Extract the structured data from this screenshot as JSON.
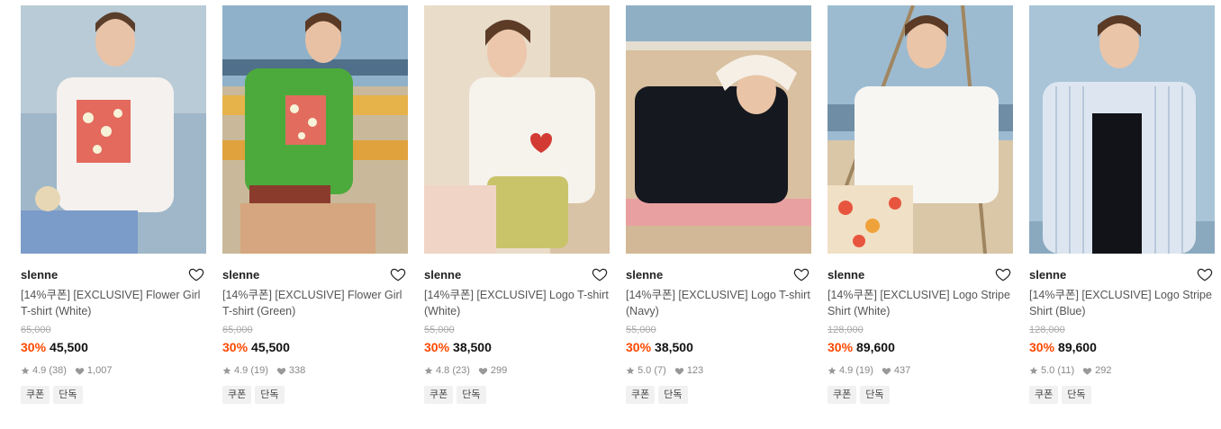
{
  "colors": {
    "discount": "#ff4800",
    "tag_bg": "#f1f1f1"
  },
  "products": [
    {
      "brand": "slenne",
      "title": "[14%쿠폰] [EXCLUSIVE] Flower Girl T-shirt (White)",
      "original_price": "65,000",
      "discount": "30%",
      "price": "45,500",
      "rating": "4.9",
      "reviews": "(38)",
      "likes": "1,007",
      "tags": [
        "쿠폰",
        "단독"
      ]
    },
    {
      "brand": "slenne",
      "title": "[14%쿠폰] [EXCLUSIVE] Flower Girl T-shirt (Green)",
      "original_price": "65,000",
      "discount": "30%",
      "price": "45,500",
      "rating": "4.9",
      "reviews": "(19)",
      "likes": "338",
      "tags": [
        "쿠폰",
        "단독"
      ]
    },
    {
      "brand": "slenne",
      "title": "[14%쿠폰] [EXCLUSIVE] Logo T-shirt (White)",
      "original_price": "55,000",
      "discount": "30%",
      "price": "38,500",
      "rating": "4.8",
      "reviews": "(23)",
      "likes": "299",
      "tags": [
        "쿠폰",
        "단독"
      ]
    },
    {
      "brand": "slenne",
      "title": "[14%쿠폰] [EXCLUSIVE] Logo T-shirt (Navy)",
      "original_price": "55,000",
      "discount": "30%",
      "price": "38,500",
      "rating": "5.0",
      "reviews": "(7)",
      "likes": "123",
      "tags": [
        "쿠폰",
        "단독"
      ]
    },
    {
      "brand": "slenne",
      "title": "[14%쿠폰] [EXCLUSIVE] Logo Stripe Shirt (White)",
      "original_price": "128,000",
      "discount": "30%",
      "price": "89,600",
      "rating": "4.9",
      "reviews": "(19)",
      "likes": "437",
      "tags": [
        "쿠폰",
        "단독"
      ]
    },
    {
      "brand": "slenne",
      "title": "[14%쿠폰] [EXCLUSIVE] Logo Stripe Shirt (Blue)",
      "original_price": "128,000",
      "discount": "30%",
      "price": "89,600",
      "rating": "5.0",
      "reviews": "(11)",
      "likes": "292",
      "tags": [
        "쿠폰",
        "단독"
      ]
    }
  ]
}
